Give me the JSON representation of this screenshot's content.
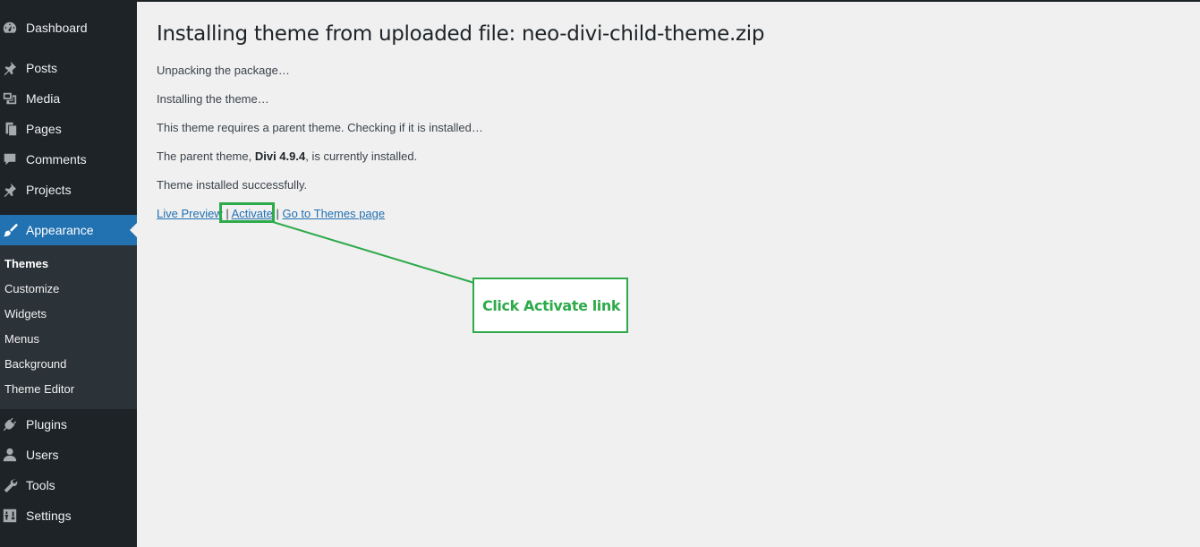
{
  "sidebar": {
    "items": [
      {
        "label": "Dashboard",
        "icon": "dashboard-icon"
      },
      {
        "label": "Posts",
        "icon": "pin-icon"
      },
      {
        "label": "Media",
        "icon": "media-icon"
      },
      {
        "label": "Pages",
        "icon": "pages-icon"
      },
      {
        "label": "Comments",
        "icon": "comment-icon"
      },
      {
        "label": "Projects",
        "icon": "pin-icon"
      },
      {
        "label": "Appearance",
        "icon": "paintbrush-icon"
      },
      {
        "label": "Plugins",
        "icon": "plug-icon"
      },
      {
        "label": "Users",
        "icon": "user-icon"
      },
      {
        "label": "Tools",
        "icon": "wrench-icon"
      },
      {
        "label": "Settings",
        "icon": "sliders-icon"
      }
    ],
    "submenu": [
      "Themes",
      "Customize",
      "Widgets",
      "Menus",
      "Background",
      "Theme Editor"
    ]
  },
  "main": {
    "title": "Installing theme from uploaded file: neo-divi-child-theme.zip",
    "messages": {
      "unpacking": "Unpacking the package…",
      "installing": "Installing the theme…",
      "requires_parent": "This theme requires a parent theme. Checking if it is installed…",
      "parent_prefix": "The parent theme, ",
      "parent_name": "Divi 4.9.4",
      "parent_suffix": ", is currently installed.",
      "success": "Theme installed successfully."
    },
    "actions": {
      "live_preview": "Live Preview",
      "separator": " | ",
      "activate": "Activate",
      "go_to_themes": "Go to Themes page"
    }
  },
  "annotation": {
    "callout_text": "Click Activate link",
    "color": "#2eaa4a"
  },
  "colors": {
    "sidebar_bg": "#1d2327",
    "submenu_bg": "#2c3338",
    "accent": "#2271b1",
    "content_bg": "#f0f0f1"
  }
}
